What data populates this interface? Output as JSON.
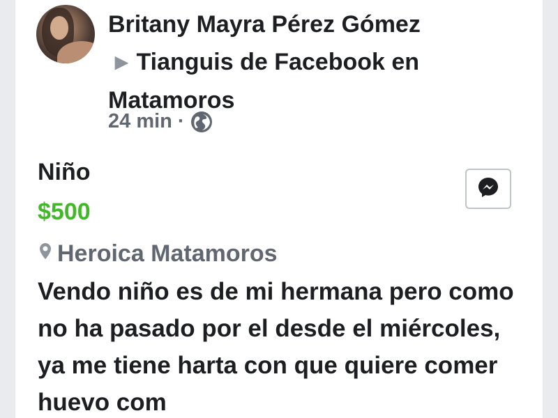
{
  "post": {
    "author_name": "Britany Mayra Pérez Gómez",
    "group_name": "Tianguis de Facebook en Matamoros",
    "time": "24 min",
    "separator": "·",
    "privacy_icon": "globe-icon"
  },
  "listing": {
    "title": "Niño",
    "price": "$500",
    "location": "Heroica Matamoros",
    "location_icon": "map-pin-icon",
    "description": "Vendo niño es de mi hermana pero como no ha pasado por el desde el miércoles, ya me tiene harta con que quiere comer huevo com"
  },
  "actions": {
    "message_icon": "messenger-icon"
  },
  "colors": {
    "price": "#42b72a",
    "meta": "#616770",
    "background": "#e9ebee"
  }
}
